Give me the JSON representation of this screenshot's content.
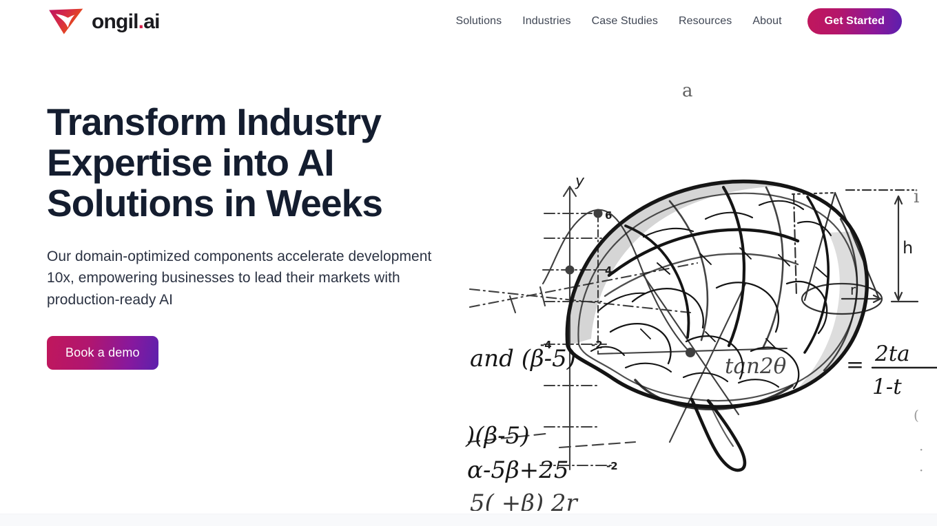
{
  "brand": {
    "name_main": "ongil",
    "name_dot": ".",
    "name_suffix": "ai",
    "logo_icon": "ongil-triangle-bird-logo",
    "gradient_start": "#c2185b",
    "gradient_end": "#e8521f"
  },
  "nav": {
    "items": [
      {
        "label": "Solutions"
      },
      {
        "label": "Industries"
      },
      {
        "label": "Case Studies"
      },
      {
        "label": "Resources"
      },
      {
        "label": "About"
      }
    ],
    "cta_label": "Get Started",
    "cta_gradient_start": "#c0175c",
    "cta_gradient_end": "#5b1fae",
    "link_color": "#3f4654"
  },
  "hero": {
    "title": "Transform Industry Expertise into AI Solutions in Weeks",
    "subtitle": "Our domain-optimized components accelerate development 10x, empowering businesses to lead their markets with production-ready AI",
    "cta_label": "Book a demo",
    "cta_gradient_start": "#c0175c",
    "cta_gradient_end": "#5c21ad",
    "title_color": "#141d2f",
    "background_color": "#ffffff"
  },
  "hero_art": {
    "description": "Hand-drawn pencil sketch of a human brain overlaid on handwritten mathematics notes",
    "annotations": {
      "axis_label_y": "y",
      "axis_ticks": [
        "6",
        "4",
        "-2",
        "-4"
      ],
      "cone_height_label": "h",
      "cone_radius_label": "r",
      "formula_top": "and (β-5)",
      "formula_second": "(β-5)",
      "formula_third": "α-5β+25",
      "formula_right_numerator": "2ta",
      "formula_right_denominator": "1-t",
      "formula_right_lhs": "tan2θ =",
      "stray_top": "a"
    },
    "ink_color": "#1a1a1a",
    "paper_color": "#ffffff"
  },
  "footer_band": {
    "background_color": "#f8f9fb"
  }
}
